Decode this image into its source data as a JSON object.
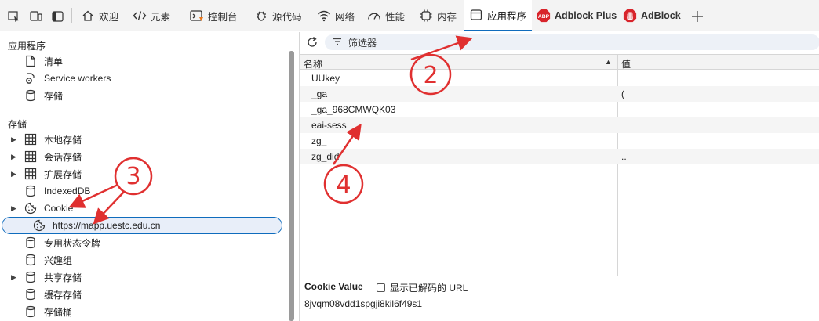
{
  "tabs": [
    {
      "label": "欢迎",
      "icon": "home-icon"
    },
    {
      "label": "元素",
      "icon": "code-icon"
    },
    {
      "label": "控制台",
      "icon": "console-icon"
    },
    {
      "label": "源代码",
      "icon": "bug-icon"
    },
    {
      "label": "网络",
      "icon": "wifi-icon"
    },
    {
      "label": "性能",
      "icon": "gauge-icon"
    },
    {
      "label": "内存",
      "icon": "memory-chip-icon"
    },
    {
      "label": "应用程序",
      "icon": "application-icon"
    },
    {
      "label": "Adblock Plus",
      "icon": "abp-icon",
      "badge": "ABP"
    },
    {
      "label": "AdBlock",
      "icon": "adblock-hand-icon"
    }
  ],
  "sidebar": {
    "application": {
      "heading": "应用程序",
      "items": [
        {
          "label": "清单",
          "icon": "document-icon"
        },
        {
          "label": "Service workers",
          "icon": "gear-icon"
        },
        {
          "label": "存储",
          "icon": "database-icon"
        }
      ]
    },
    "storage": {
      "heading": "存储",
      "items": [
        {
          "label": "本地存储",
          "icon": "grid-icon",
          "expandable": true
        },
        {
          "label": "会话存储",
          "icon": "grid-icon",
          "expandable": true
        },
        {
          "label": "扩展存储",
          "icon": "grid-icon",
          "expandable": true
        },
        {
          "label": "IndexedDB",
          "icon": "database-icon",
          "expandable": false
        },
        {
          "label": "Cookie",
          "icon": "cookie-icon",
          "expandable": true
        },
        {
          "label": "https://mapp.uestc.edu.cn",
          "icon": "cookie-icon",
          "selected": true
        },
        {
          "label": "专用状态令牌",
          "icon": "database-icon",
          "expandable": false
        },
        {
          "label": "兴趣组",
          "icon": "database-icon",
          "expandable": false
        },
        {
          "label": "共享存储",
          "icon": "database-icon",
          "expandable": true
        },
        {
          "label": "缓存存储",
          "icon": "database-icon",
          "expandable": false
        },
        {
          "label": "存储桶",
          "icon": "database-icon",
          "expandable": false
        }
      ]
    }
  },
  "cookies": {
    "filter_placeholder": "筛选器",
    "columns": {
      "name": "名称",
      "value": "值"
    },
    "rows": [
      {
        "name": "UUkey",
        "value": ""
      },
      {
        "name": "_ga",
        "value": "("
      },
      {
        "name": "_ga_968CMWQK03",
        "value": ""
      },
      {
        "name": "eai-sess",
        "value": ""
      },
      {
        "name": "zg_",
        "value": ""
      },
      {
        "name": "zg_did",
        "value": ".."
      }
    ],
    "detail": {
      "label": "Cookie Value",
      "checkbox_label": "显示已解码的 URL",
      "value": "8jvqm08vdd1spgji8kil6f49s1"
    }
  },
  "annotations": [
    {
      "number": "2",
      "color": "#e03030"
    },
    {
      "number": "3",
      "color": "#e03030"
    },
    {
      "number": "4",
      "color": "#e03030"
    }
  ]
}
